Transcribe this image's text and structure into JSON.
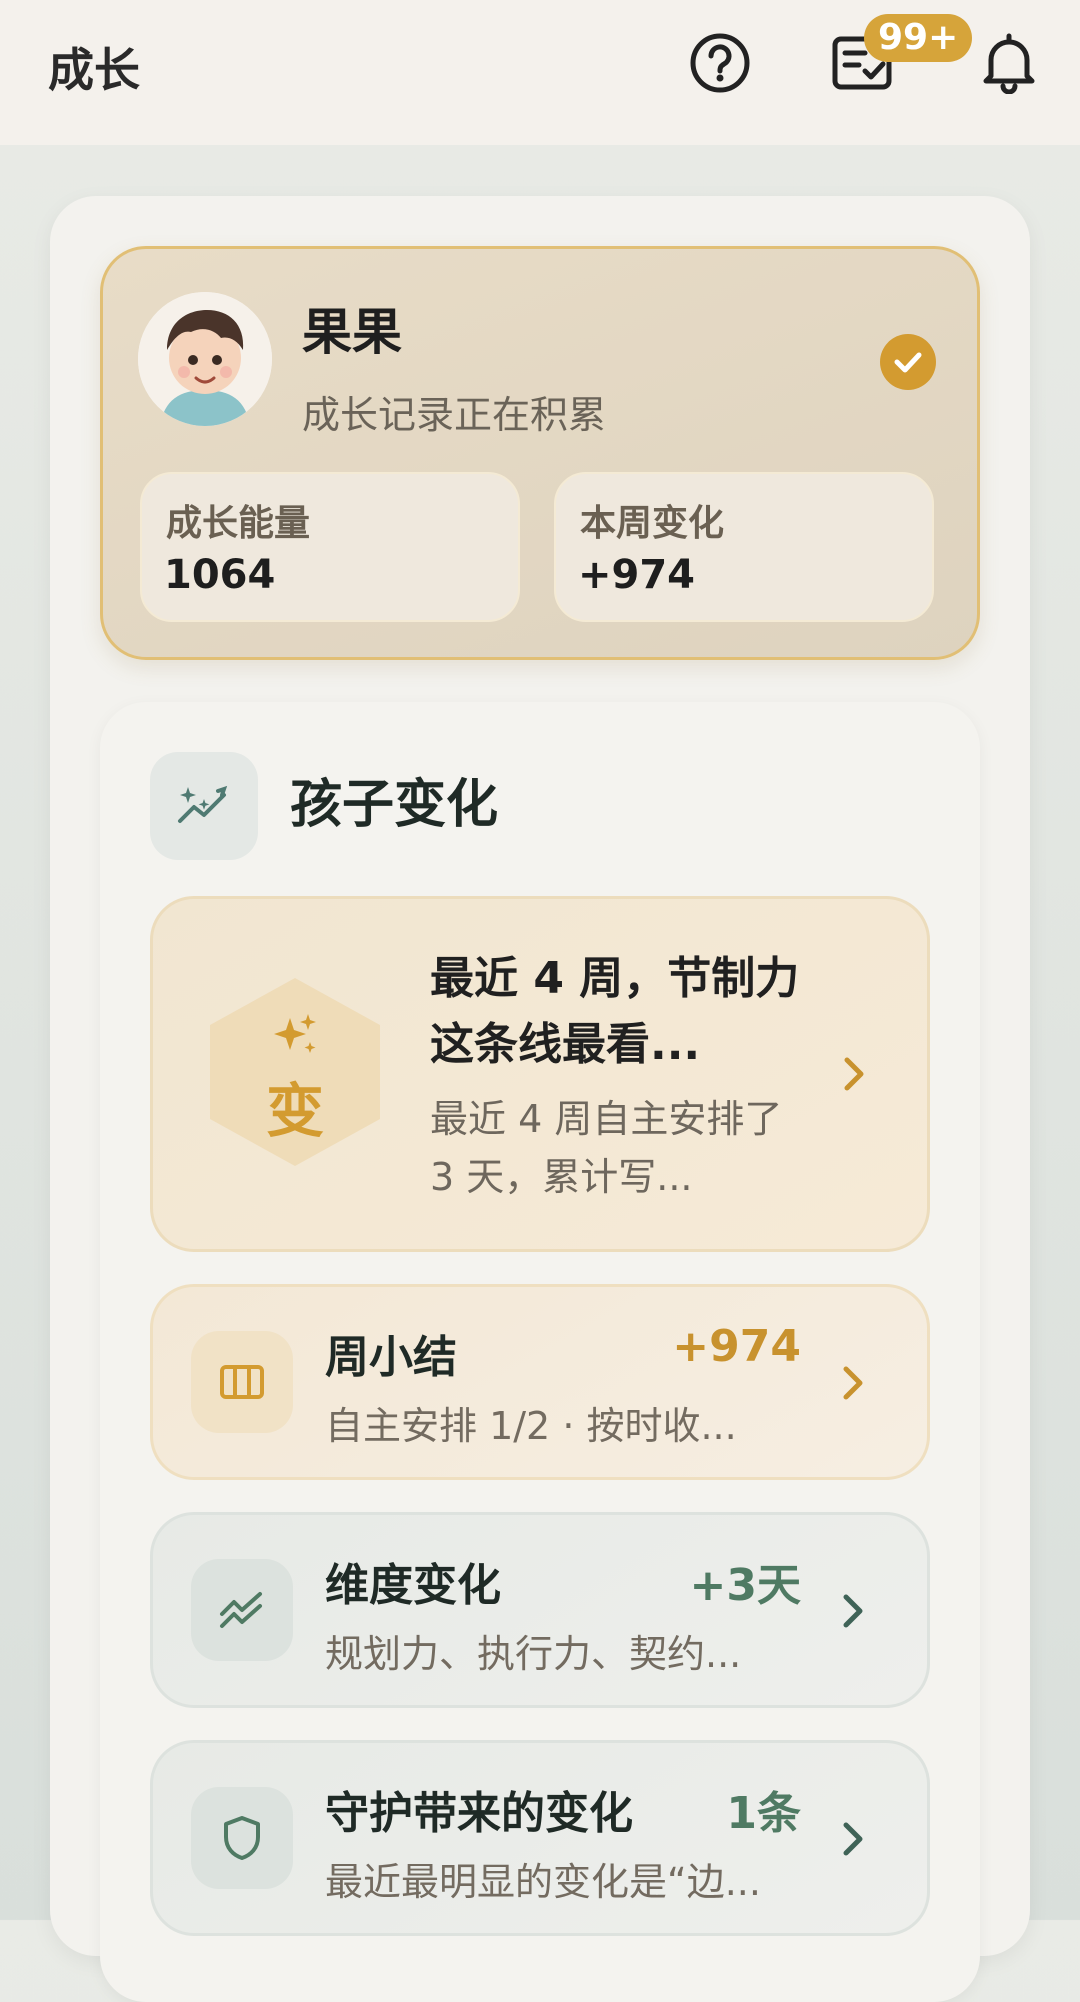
{
  "header": {
    "title": "成长",
    "notification_badge": "99+"
  },
  "profile": {
    "name": "果果",
    "subtitle": "成长记录正在积累",
    "stats": [
      {
        "label": "成长能量",
        "value": "1064"
      },
      {
        "label": "本周变化",
        "value": "+974"
      }
    ]
  },
  "section": {
    "title": "孩子变化",
    "highlight": {
      "badge_char": "变",
      "title": "最近 4 周，节制力这条线最看...",
      "desc": "最近 4 周自主安排了 3 天，累计写..."
    },
    "rows": [
      {
        "title": "周小结",
        "value": "+974",
        "desc": "自主安排 1/2 · 按时收..."
      },
      {
        "title": "维度变化",
        "value": "+3天",
        "desc": "规划力、执行力、契约..."
      },
      {
        "title": "守护带来的变化",
        "value": "1条",
        "desc": "最近最明显的变化是“边..."
      }
    ]
  },
  "colors": {
    "accent_gold": "#d39b30",
    "accent_green": "#4f7a63"
  },
  "icons": [
    "help-icon",
    "checklist-icon",
    "bell-icon",
    "check-circle-icon",
    "sparkle-trend-icon",
    "sparkle-icon",
    "calendar-icon",
    "trend-icon",
    "shield-icon",
    "chevron-right-icon"
  ]
}
